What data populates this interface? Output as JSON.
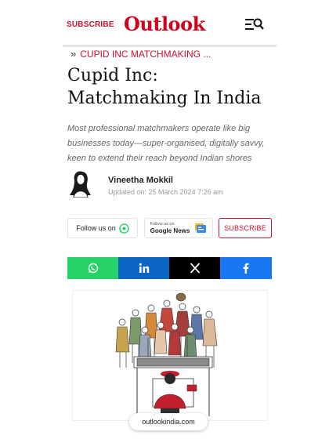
{
  "header": {
    "subscribe_label": "SUBSCRIBE",
    "logo_text": "Outlook",
    "menu_icon": "menu-search-icon"
  },
  "breadcrumb": {
    "chevron": "»",
    "label": "CUPID INC MATCHMAKING ..."
  },
  "article": {
    "title": "Cupid Inc: Matchmaking In India",
    "summary": "Most professional matchmakers operate like big businesses today—super-organised, digitally savvy, keen to extend their reach beyond Indian shores",
    "author": "Vineetha Mokkil",
    "updated": "Updated on: 25 March 2024 7:26 am"
  },
  "follow": {
    "whatsapp_label": "Follow us on",
    "google_small": "Follow us on",
    "google_big": "Google News",
    "subscribe_label": "SUBSCRIBE"
  },
  "share": {
    "icons": [
      "whatsapp-icon",
      "linkedin-icon",
      "x-icon",
      "facebook-icon"
    ]
  },
  "browser": {
    "url": "outlookindia.com"
  },
  "colors": {
    "brand_red": "#c8102e",
    "whatsapp": "#25d366",
    "linkedin": "#0a66c2",
    "x": "#000000",
    "facebook": "#1877f2"
  }
}
